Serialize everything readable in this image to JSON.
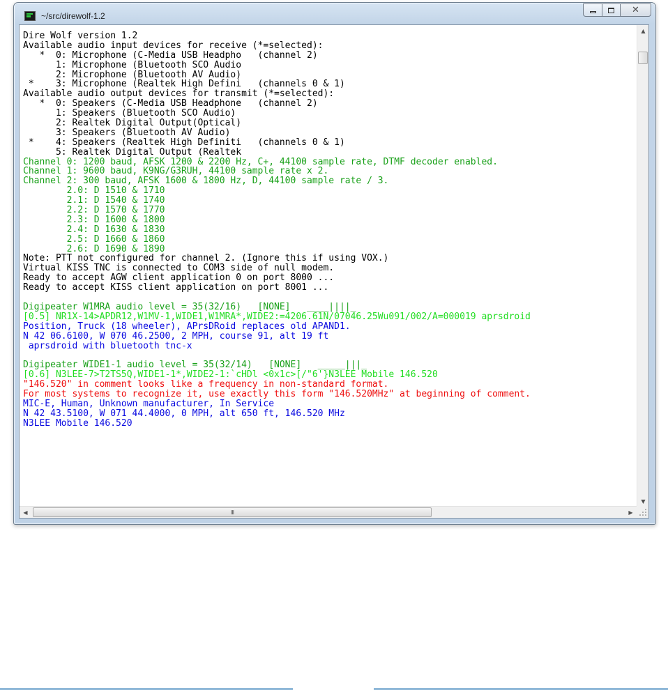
{
  "window": {
    "title": "~/src/direwolf-1.2"
  },
  "controls": {
    "minimize_icon": "minimize-icon",
    "maximize_icon": "maximize-icon",
    "close_icon": "close-icon"
  },
  "colors": {
    "black": "#000000",
    "green": "#18a018",
    "light_green": "#22dd22",
    "blue": "#0a0ae0",
    "red": "#ee1111"
  },
  "terminal": {
    "lines": [
      {
        "text": "Dire Wolf version 1.2",
        "color": "black"
      },
      {
        "text": "Available audio input devices for receive (*=selected):",
        "color": "black"
      },
      {
        "text": "   *  0: Microphone (C-Media USB Headpho   (channel 2)",
        "color": "black"
      },
      {
        "text": "      1: Microphone (Bluetooth SCO Audio",
        "color": "black"
      },
      {
        "text": "      2: Microphone (Bluetooth AV Audio)",
        "color": "black"
      },
      {
        "text": " *    3: Microphone (Realtek High Defini   (channels 0 & 1)",
        "color": "black"
      },
      {
        "text": "Available audio output devices for transmit (*=selected):",
        "color": "black"
      },
      {
        "text": "   *  0: Speakers (C-Media USB Headphone   (channel 2)",
        "color": "black"
      },
      {
        "text": "      1: Speakers (Bluetooth SCO Audio)",
        "color": "black"
      },
      {
        "text": "      2: Realtek Digital Output(Optical)",
        "color": "black"
      },
      {
        "text": "      3: Speakers (Bluetooth AV Audio)",
        "color": "black"
      },
      {
        "text": " *    4: Speakers (Realtek High Definiti   (channels 0 & 1)",
        "color": "black"
      },
      {
        "text": "      5: Realtek Digital Output (Realtek",
        "color": "black"
      },
      {
        "text": "Channel 0: 1200 baud, AFSK 1200 & 2200 Hz, C+, 44100 sample rate, DTMF decoder enabled.",
        "color": "green"
      },
      {
        "text": "Channel 1: 9600 baud, K9NG/G3RUH, 44100 sample rate x 2.",
        "color": "green"
      },
      {
        "text": "Channel 2: 300 baud, AFSK 1600 & 1800 Hz, D, 44100 sample rate / 3.",
        "color": "green"
      },
      {
        "text": "        2.0: D 1510 & 1710",
        "color": "green"
      },
      {
        "text": "        2.1: D 1540 & 1740",
        "color": "green"
      },
      {
        "text": "        2.2: D 1570 & 1770",
        "color": "green"
      },
      {
        "text": "        2.3: D 1600 & 1800",
        "color": "green"
      },
      {
        "text": "        2.4: D 1630 & 1830",
        "color": "green"
      },
      {
        "text": "        2.5: D 1660 & 1860",
        "color": "green"
      },
      {
        "text": "        2.6: D 1690 & 1890",
        "color": "green"
      },
      {
        "text": "Note: PTT not configured for channel 2. (Ignore this if using VOX.)",
        "color": "black"
      },
      {
        "text": "Virtual KISS TNC is connected to COM3 side of null modem.",
        "color": "black"
      },
      {
        "text": "Ready to accept AGW client application 0 on port 8000 ...",
        "color": "black"
      },
      {
        "text": "Ready to accept KISS client application on port 8001 ...",
        "color": "black"
      },
      {
        "text": "",
        "color": "black"
      },
      {
        "text": "Digipeater W1MRA audio level = 35(32/16)   [NONE]   ____||||_",
        "color": "green"
      },
      {
        "text": "[0.5] NR1X-14>APDR12,W1MV-1,WIDE1,W1MRA*,WIDE2:=4206.61N/07046.25Wu091/002/A=000019 aprsdroid",
        "color": "light_green"
      },
      {
        "text": "Position, Truck (18 wheeler), APrsDRoid replaces old APAND1.",
        "color": "blue"
      },
      {
        "text": "N 42 06.6100, W 070 46.2500, 2 MPH, course 91, alt 19 ft",
        "color": "blue"
      },
      {
        "text": " aprsdroid with bluetooth tnc-x",
        "color": "blue"
      },
      {
        "text": "",
        "color": "black"
      },
      {
        "text": "Digipeater WIDE1-1 audio level = 35(32/14)   [NONE]   _____|||_",
        "color": "green"
      },
      {
        "text": "[0.6] N3LEE-7>T2TS5Q,WIDE1-1*,WIDE2-1:`cHDl <0x1c>[/\"6'}N3LEE Mobile 146.520",
        "color": "light_green"
      },
      {
        "text": "\"146.520\" in comment looks like a frequency in non-standard format.",
        "color": "red"
      },
      {
        "text": "For most systems to recognize it, use exactly this form \"146.520MHz\" at beginning of comment.",
        "color": "red"
      },
      {
        "text": "MIC-E, Human, Unknown manufacturer, In Service",
        "color": "blue"
      },
      {
        "text": "N 42 43.5100, W 071 44.4000, 0 MPH, alt 650 ft, 146.520 MHz",
        "color": "blue"
      },
      {
        "text": "N3LEE Mobile 146.520",
        "color": "blue"
      }
    ]
  },
  "scrollbars": {
    "up_arrow": "▲",
    "down_arrow": "▼",
    "left_arrow": "◀",
    "right_arrow": "▶",
    "thumb_grip": "III"
  }
}
